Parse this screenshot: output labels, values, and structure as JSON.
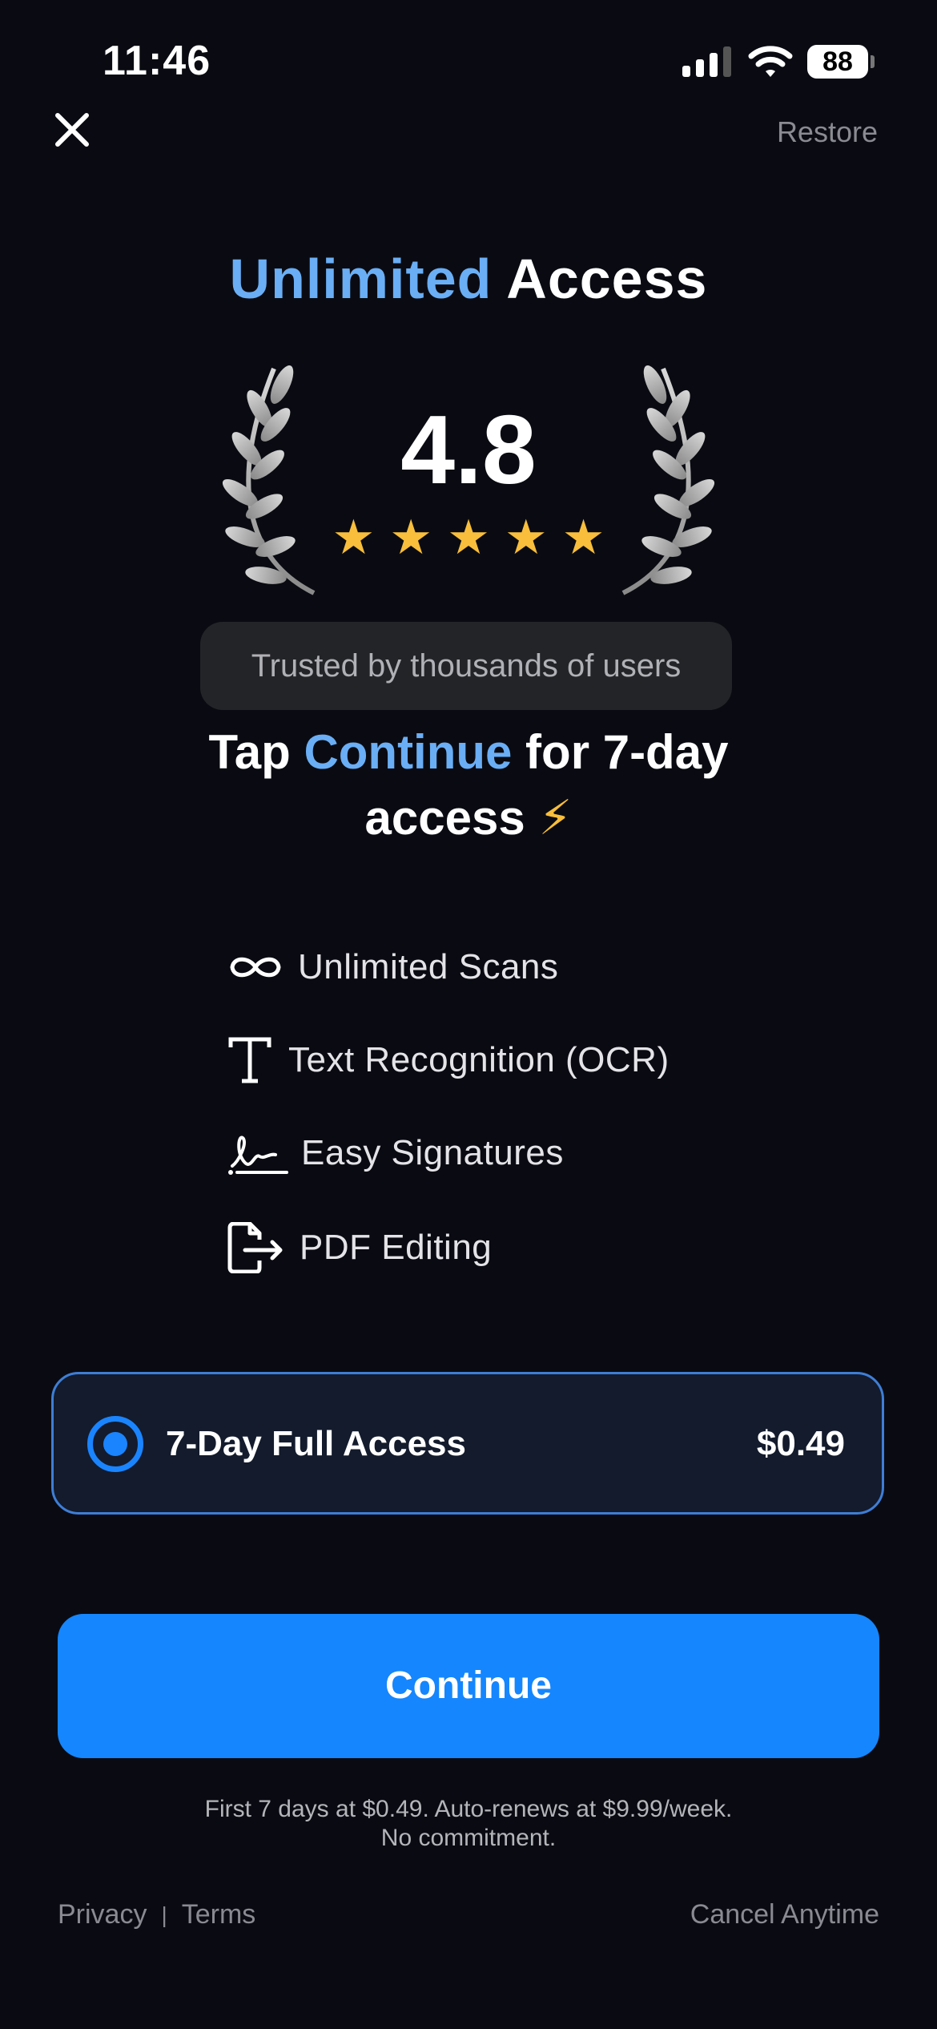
{
  "status_bar": {
    "time": "11:46",
    "battery": "88"
  },
  "nav": {
    "restore_label": "Restore"
  },
  "title": {
    "accent": "Unlimited",
    "rest": " Access"
  },
  "rating": {
    "value": "4.8",
    "stars": "★★★★★",
    "star_count": 5,
    "trusted_label": "Trusted by thousands of users"
  },
  "tap": {
    "prefix": "Tap ",
    "accent": "Continue",
    "suffix": " for 7-day",
    "line2": "access ",
    "emoji": "⚡"
  },
  "features": [
    {
      "icon": "infinity-icon",
      "label": "Unlimited Scans"
    },
    {
      "icon": "text-icon",
      "label": "Text Recognition (OCR)"
    },
    {
      "icon": "signature-icon",
      "label": "Easy Signatures"
    },
    {
      "icon": "pdf-export-icon",
      "label": "PDF Editing"
    }
  ],
  "plan": {
    "name": "7-Day Full Access",
    "price": "$0.49",
    "selected": true
  },
  "continue_label": "Continue",
  "fine_print": {
    "line1": "First 7 days at $0.49. Auto-renews at $9.99/week.",
    "line2": "No commitment."
  },
  "footer": {
    "privacy": "Privacy",
    "separator": "|",
    "terms": "Terms",
    "cancel": "Cancel Anytime"
  },
  "colors": {
    "accent": "#6aaef5",
    "primary": "#1586fd",
    "star": "#f8be3c",
    "background": "#0a0b12"
  }
}
